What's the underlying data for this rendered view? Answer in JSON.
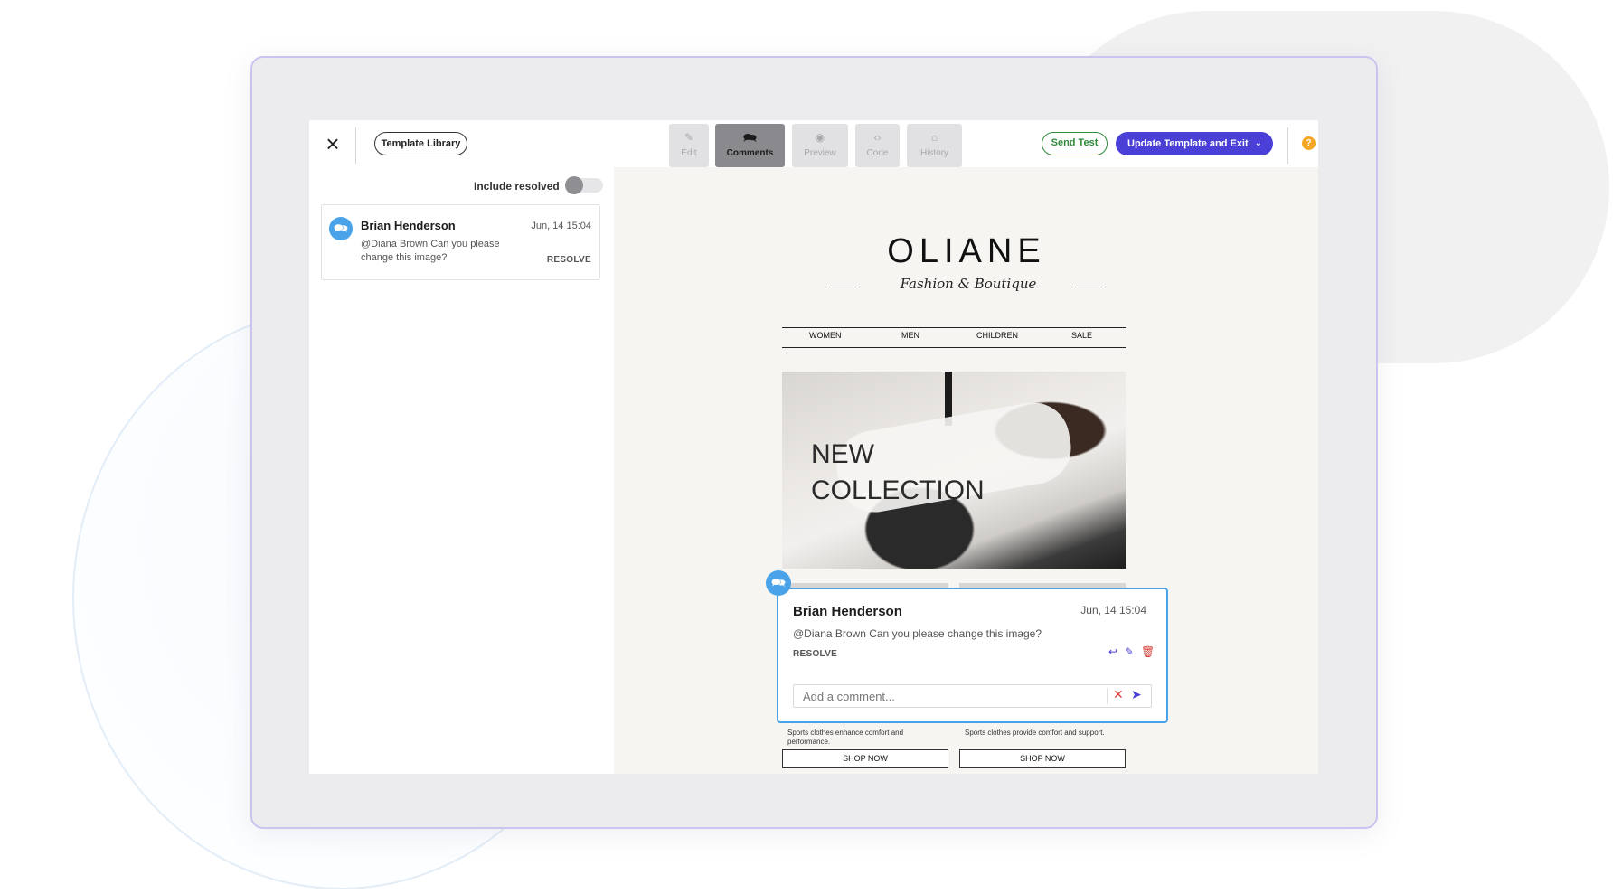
{
  "toolbar": {
    "template_library": "Template Library",
    "tabs": [
      {
        "label": "Edit",
        "icon": "pencil-icon",
        "glyph": "✎"
      },
      {
        "label": "Comments",
        "icon": "comment-icon",
        "glyph": "🗪"
      },
      {
        "label": "Preview",
        "icon": "eye-icon",
        "glyph": "◉"
      },
      {
        "label": "Code",
        "icon": "code-icon",
        "glyph": "‹›"
      },
      {
        "label": "History",
        "icon": "history-icon",
        "glyph": "⌂"
      }
    ],
    "active_tab": "Comments",
    "send_test": "Send Test",
    "update_exit": "Update Template and Exit",
    "help": "?"
  },
  "comments_panel": {
    "include_resolved_label": "Include resolved",
    "include_resolved": false,
    "comments": [
      {
        "author": "Brian Henderson",
        "date": "Jun, 14 15:04",
        "text": "@Diana Brown Can you please change this image?",
        "resolve_label": "RESOLVE"
      }
    ]
  },
  "email_preview": {
    "brand": "OLIANE",
    "tagline": "Fashion & Boutique",
    "nav": [
      "WOMEN",
      "MEN",
      "CHILDREN",
      "SALE"
    ],
    "hero_title": "NEW\nCOLLECTION",
    "blurb_left": "Sports clothes enhance comfort and performance.",
    "blurb_right": "Sports clothes provide comfort and support.",
    "shop_now_left": "SHOP NOW",
    "shop_now_right": "SHOP NOW"
  },
  "comment_popup": {
    "author": "Brian Henderson",
    "date": "Jun, 14 15:04",
    "text": "@Diana Brown Can you please change this image?",
    "resolve_label": "RESOLVE",
    "input_placeholder": "Add a comment..."
  },
  "colors": {
    "accent": "#4a3fd6",
    "comment_blue": "#4aa3e8",
    "send_test_green": "#2f8a3a",
    "help_orange": "#f5a623"
  }
}
